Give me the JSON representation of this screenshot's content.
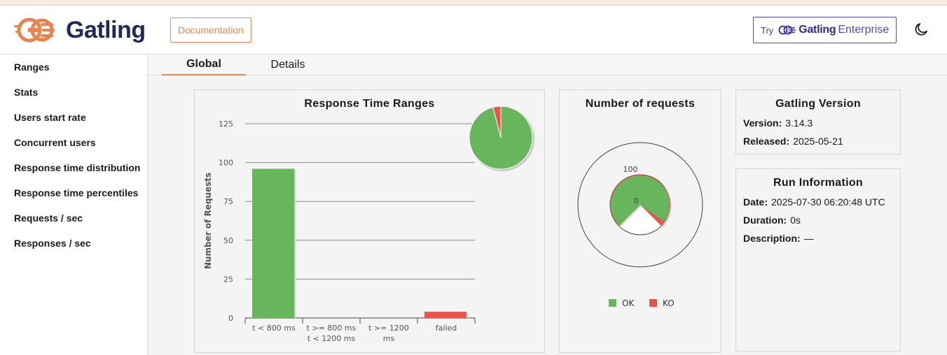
{
  "header": {
    "logo_text": "Gatling",
    "documentation_label": "Documentation",
    "enterprise": {
      "try_label": "Try",
      "name": "Gatling",
      "suffix": "Enterprise"
    },
    "theme_icon": "moon-icon"
  },
  "sidebar": {
    "items": [
      {
        "label": "Ranges"
      },
      {
        "label": "Stats"
      },
      {
        "label": "Users start rate"
      },
      {
        "label": "Concurrent users"
      },
      {
        "label": "Response time distribution"
      },
      {
        "label": "Response time percentiles"
      },
      {
        "label": "Requests / sec"
      },
      {
        "label": "Responses / sec"
      }
    ]
  },
  "tabs": [
    {
      "label": "Global",
      "active": true
    },
    {
      "label": "Details",
      "active": false
    }
  ],
  "colors": {
    "ok": "#68b65c",
    "ko": "#e8544a",
    "accent": "#e8854e",
    "enterprise": "#4c4cc4"
  },
  "chart_data": [
    {
      "type": "bar",
      "title": "Response Time Ranges",
      "ylabel": "Number of Requests",
      "categories": [
        "t < 800 ms",
        "t >= 800 ms t < 1200 ms",
        "t >= 1200 ms",
        "failed"
      ],
      "category_lines": [
        [
          "t < 800 ms"
        ],
        [
          "t >= 800 ms",
          "t < 1200 ms"
        ],
        [
          "t >= 1200",
          "ms"
        ],
        [
          "failed"
        ]
      ],
      "values": [
        96,
        0,
        0,
        4
      ],
      "bar_colors": [
        "#68b65c",
        "#68b65c",
        "#68b65c",
        "#e8544a"
      ],
      "ylim": [
        0,
        125
      ],
      "yticks": [
        0,
        25,
        50,
        75,
        100,
        125
      ],
      "grid": true,
      "inset_pie": {
        "values": [
          96,
          4
        ],
        "colors": [
          "#68b65c",
          "#e8544a"
        ]
      }
    },
    {
      "type": "pie",
      "title": "Number of requests",
      "series": [
        {
          "name": "OK",
          "value": 96,
          "color": "#68b65c"
        },
        {
          "name": "KO",
          "value": 4,
          "color": "#e8544a"
        }
      ],
      "scale_labels": [
        "100",
        "0"
      ],
      "legend": "bottom"
    }
  ],
  "gatling_version": {
    "title": "Gatling Version",
    "version_label": "Version:",
    "version": "3.14.3",
    "released_label": "Released:",
    "released": "2025-05-21"
  },
  "run_info": {
    "title": "Run Information",
    "date_label": "Date:",
    "date": "2025-07-30 06:20:48 UTC",
    "duration_label": "Duration:",
    "duration": "0s",
    "description_label": "Description:",
    "description": "—"
  }
}
